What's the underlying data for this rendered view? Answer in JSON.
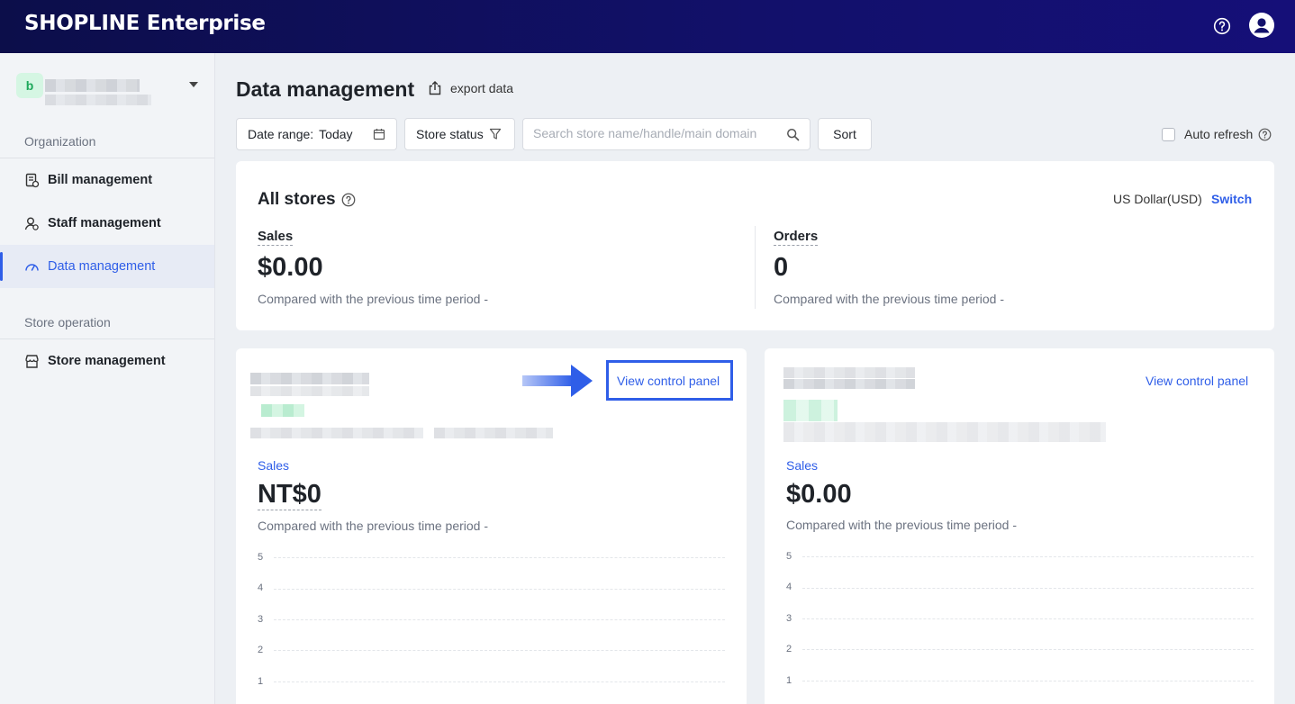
{
  "header": {
    "brand": "SHOPLINE Enterprise",
    "help_icon": "help-circle-icon",
    "avatar_icon": "user-avatar-icon"
  },
  "sidebar": {
    "org_badge": "b",
    "section_organization": "Organization",
    "section_store_operation": "Store operation",
    "items": [
      {
        "label": "Bill management",
        "icon": "bill-icon"
      },
      {
        "label": "Staff management",
        "icon": "staff-icon"
      },
      {
        "label": "Data management",
        "icon": "dashboard-gauge-icon",
        "active": true
      },
      {
        "label": "Store management",
        "icon": "store-icon"
      }
    ]
  },
  "main": {
    "title": "Data management",
    "export_label": "export data",
    "filters": {
      "date_range_label": "Date range:",
      "date_range_value": "Today",
      "store_status_label": "Store status",
      "search_placeholder": "Search store name/handle/main domain",
      "sort_label": "Sort",
      "auto_refresh_label": "Auto refresh"
    },
    "all_stores": {
      "title": "All stores",
      "currency": "US Dollar(USD)",
      "switch_label": "Switch",
      "sales_label": "Sales",
      "sales_value": "$0.00",
      "sales_compare": "Compared with the previous time period -",
      "orders_label": "Orders",
      "orders_value": "0",
      "orders_compare": "Compared with the previous time period -"
    },
    "stores": [
      {
        "view_label": "View control panel",
        "sales_label": "Sales",
        "sales_value": "NT$0",
        "compare": "Compared with the previous time period -",
        "y_ticks": [
          "5",
          "4",
          "3",
          "2",
          "1"
        ]
      },
      {
        "view_label": "View control panel",
        "sales_label": "Sales",
        "sales_value": "$0.00",
        "compare": "Compared with the previous time period -",
        "y_ticks": [
          "5",
          "4",
          "3",
          "2",
          "1"
        ]
      }
    ]
  },
  "colors": {
    "accent": "#2f5ee8",
    "topbar": "#12106b",
    "badge_bg": "#d5f6e3",
    "badge_text": "#1ea85b"
  }
}
